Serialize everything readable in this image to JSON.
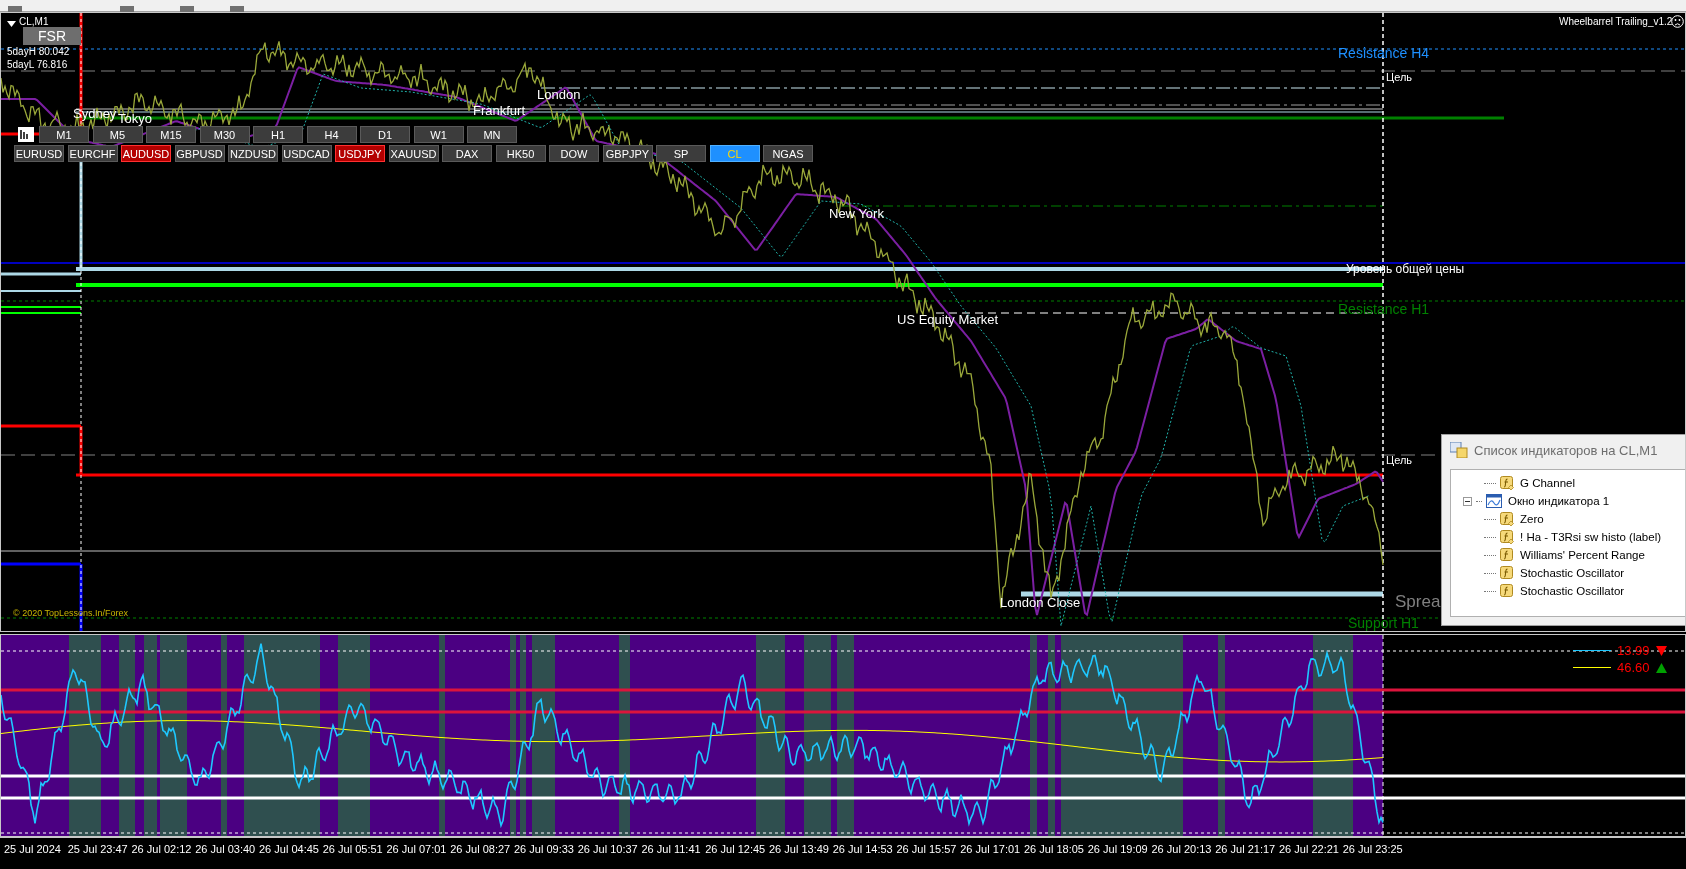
{
  "chart": {
    "symbol": "CL,M1",
    "fsr": "FSR",
    "day_high": "5dayH 80.042",
    "day_low": "5dayL 76.816",
    "expert": "Wheelbarrel Trailing_v1.2",
    "copyright": "© 2020 TopLessons.In/Forex",
    "spread": "Sprea",
    "labels": [
      {
        "text": "Resistance H4",
        "color": "#1e90ff"
      },
      {
        "text": "Цель",
        "color": "#ffffff"
      },
      {
        "text": "Уровень общей цены",
        "color": "#ffffff"
      },
      {
        "text": "Resistance H1",
        "color": "#008000"
      },
      {
        "text": "Цель",
        "color": "#ffffff"
      },
      {
        "text": "Support H1",
        "color": "#008000"
      }
    ],
    "sessions": [
      "Sydney",
      "Tokyo",
      "Frankfurt",
      "London",
      "New York",
      "US Equity Market",
      "London Close"
    ]
  },
  "timeframes": [
    "M1",
    "M5",
    "M15",
    "M30",
    "H1",
    "H4",
    "D1",
    "W1",
    "MN"
  ],
  "symbols": [
    {
      "label": "EURUSD",
      "selected": false,
      "alert": false
    },
    {
      "label": "EURCHF",
      "selected": false,
      "alert": false
    },
    {
      "label": "AUDUSD",
      "selected": false,
      "alert": true
    },
    {
      "label": "GBPUSD",
      "selected": false,
      "alert": false
    },
    {
      "label": "NZDUSD",
      "selected": false,
      "alert": false
    },
    {
      "label": "USDCAD",
      "selected": false,
      "alert": false
    },
    {
      "label": "USDJPY",
      "selected": false,
      "alert": true
    },
    {
      "label": "XAUUSD",
      "selected": false,
      "alert": false
    },
    {
      "label": "DAX",
      "selected": false,
      "alert": false
    },
    {
      "label": "HK50",
      "selected": false,
      "alert": false
    },
    {
      "label": "DOW",
      "selected": false,
      "alert": false
    },
    {
      "label": "GBPJPY",
      "selected": false,
      "alert": false
    },
    {
      "label": "SP",
      "selected": false,
      "alert": false
    },
    {
      "label": "CL",
      "selected": true,
      "alert": false
    },
    {
      "label": "NGAS",
      "selected": false,
      "alert": false
    }
  ],
  "indicator_list": {
    "title": "Список индикаторов на CL,M1",
    "items": [
      {
        "label": "G Channel",
        "kind": "custom"
      },
      {
        "label": "Окно индикатора 1",
        "kind": "window",
        "expanded": true,
        "children": [
          {
            "label": "Zero",
            "kind": "custom"
          },
          {
            "label": "! Ha - T3Rsi sw histo (label)",
            "kind": "custom"
          },
          {
            "label": "Williams' Percent Range",
            "kind": "builtin"
          },
          {
            "label": "Stochastic Oscillator",
            "kind": "builtin"
          },
          {
            "label": "Stochastic Oscillator",
            "kind": "builtin"
          }
        ]
      }
    ]
  },
  "subwindow": {
    "legend": [
      {
        "value": "13.99",
        "color": "#1ec8ff",
        "kind": "down"
      },
      {
        "value": "46.60",
        "color": "#ffff00",
        "kind": "up"
      }
    ]
  },
  "time_axis": [
    "25 Jul 2024",
    "25 Jul 23:47",
    "26 Jul 02:12",
    "26 Jul 03:40",
    "26 Jul 04:45",
    "26 Jul 05:51",
    "26 Jul 07:01",
    "26 Jul 08:27",
    "26 Jul 09:33",
    "26 Jul 10:37",
    "26 Jul 11:41",
    "26 Jul 12:45",
    "26 Jul 13:49",
    "26 Jul 14:53",
    "26 Jul 15:57",
    "26 Jul 17:01",
    "26 Jul 18:05",
    "26 Jul 19:09",
    "26 Jul 20:13",
    "26 Jul 21:17",
    "26 Jul 22:21",
    "26 Jul 23:25"
  ]
}
